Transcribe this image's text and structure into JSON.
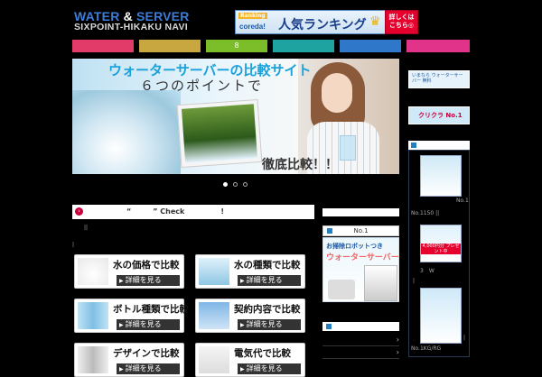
{
  "header": {
    "logo_line1_a": "WATER ",
    "logo_line1_amp": "&",
    "logo_line1_b": " SERVER",
    "logo_line2": "SIXPOINT-HIKAKU NAVI",
    "banner": {
      "tag": "Ranking",
      "brand": "coreda!",
      "title": "人気ランキング",
      "cta": "詳しくは\nこちら◎"
    }
  },
  "nav": {
    "items": [
      {
        "label": "",
        "color": "#e23b6a"
      },
      {
        "label": "",
        "color": "#c8a640"
      },
      {
        "label": "8",
        "color": "#7cbe2a"
      },
      {
        "label": "",
        "color": "#1ea3a0"
      },
      {
        "label": "",
        "color": "#2f77c9"
      },
      {
        "label": "",
        "color": "#e2338a"
      }
    ]
  },
  "slider": {
    "title": "ウォーターサーバーの比較サイト",
    "subtitle": "６つのポイントで",
    "compare": "徹底比較！！",
    "active_dot": 0
  },
  "check_bar": {
    "text": "“　　　” Check　　　　　!"
  },
  "notices": {
    "line1": "||",
    "line2": "|"
  },
  "compare_buttons": [
    {
      "label": "水の価格で比較",
      "more": "詳細を見る"
    },
    {
      "label": "水の種類で比較",
      "more": "詳細を見る"
    },
    {
      "label": "ボトル種類で比較",
      "more": "詳細を見る"
    },
    {
      "label": "契約内容で比較",
      "more": "詳細を見る"
    },
    {
      "label": "デザインで比較",
      "more": "詳細を見る"
    },
    {
      "label": "電気代で比較",
      "more": "詳細を見る"
    }
  ],
  "middle": {
    "no1_head": "No.1",
    "ad_line1": "お掃除ロボットつき",
    "ad_line2": "ウォーターサーバー",
    "rows": [
      "›",
      "›",
      "›"
    ]
  },
  "side": {
    "ad1": "いまなら ウォーターサーバー 無料",
    "ad2": "クリクラ No.1",
    "no1_label": "No.1",
    "small1": "No.1150 ||",
    "small2": "4,000円分 プレゼント中",
    "small3": "3　W",
    "small4": "|",
    "small5": "No.1KG/RG",
    "small6": "|"
  }
}
